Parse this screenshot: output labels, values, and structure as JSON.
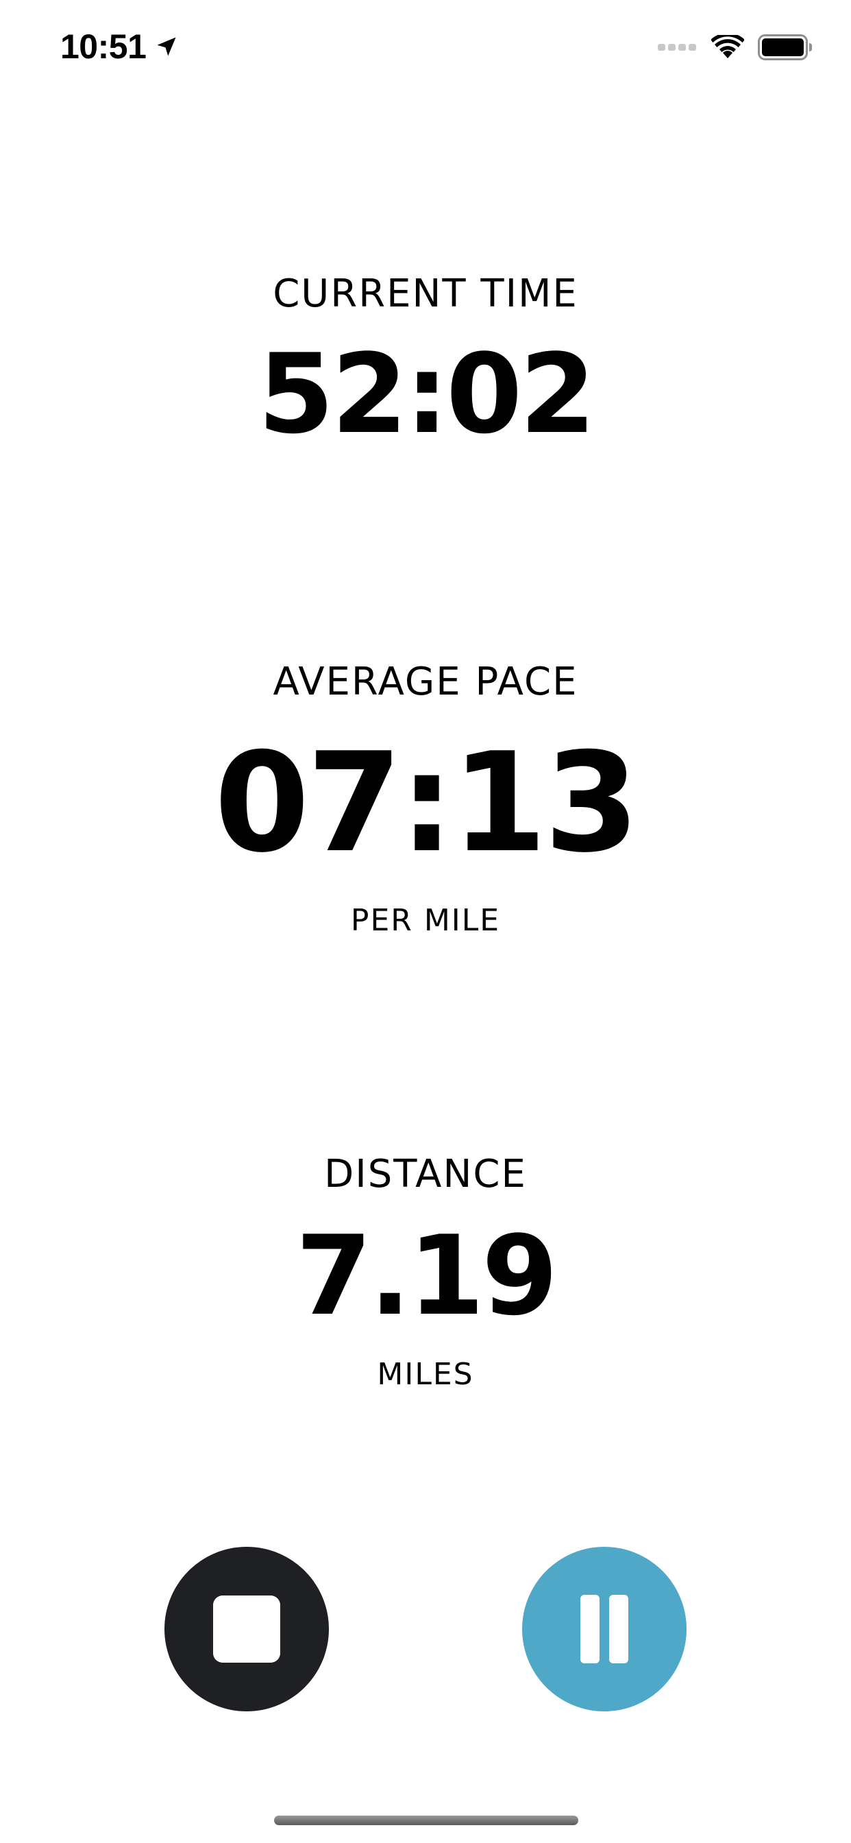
{
  "status_bar": {
    "time": "10:51",
    "location_icon": "location-arrow-icon",
    "signal_icon": "cellular-signal-icon",
    "wifi_icon": "wifi-icon",
    "battery_icon": "battery-full-icon"
  },
  "metrics": {
    "current_time": {
      "label": "CURRENT TIME",
      "value": "52:02"
    },
    "average_pace": {
      "label": "AVERAGE PACE",
      "value": "07:13",
      "unit": "PER MILE"
    },
    "distance": {
      "label": "DISTANCE",
      "value": "7.19",
      "unit": "MILES"
    }
  },
  "controls": {
    "stop": {
      "icon": "stop-icon",
      "color": "#1f2023"
    },
    "pause": {
      "icon": "pause-icon",
      "color": "#50a8c9"
    }
  },
  "colors": {
    "background": "#ffffff",
    "text": "#000000",
    "accent": "#50a8c9",
    "dark_button": "#1f2023"
  }
}
